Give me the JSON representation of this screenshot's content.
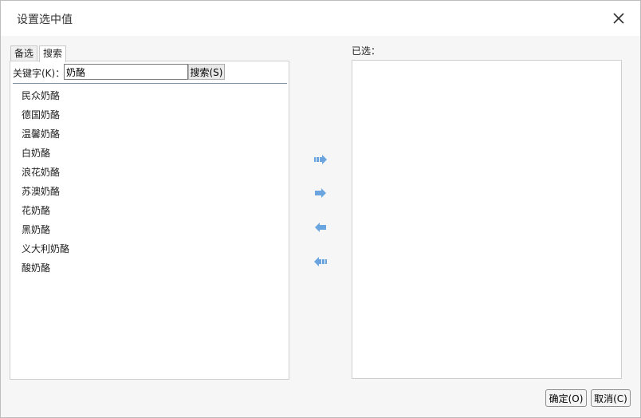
{
  "dialog": {
    "title": "设置选中值",
    "close_icon": "close-icon"
  },
  "tabs": [
    {
      "label": "备选"
    },
    {
      "label": "搜索"
    }
  ],
  "search": {
    "keyword_label": "关键字(K)：",
    "keyword_value": "奶酪",
    "button_label": "搜索(S)"
  },
  "results": [
    "民众奶酪",
    "德国奶酪",
    "温馨奶酪",
    "白奶酪",
    "浪花奶酪",
    "苏澳奶酪",
    "花奶酪",
    "黑奶酪",
    "义大利奶酪",
    "酸奶酪"
  ],
  "selected": {
    "label": "已选："
  },
  "transfer_icons": [
    "add-all-icon",
    "add-icon",
    "remove-icon",
    "remove-all-icon"
  ],
  "colors": {
    "arrow": "#6aa5df"
  },
  "footer": {
    "ok_label": "确定(O)",
    "cancel_label": "取消(C)"
  }
}
